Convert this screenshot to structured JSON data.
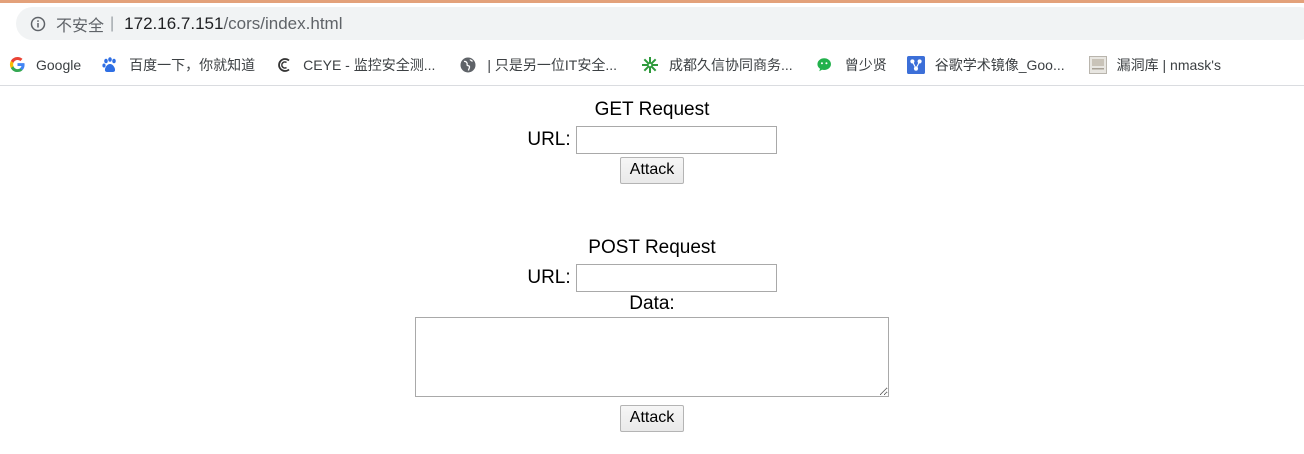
{
  "address_bar": {
    "security_label": "不安全",
    "separator": "|",
    "url_host": "172.16.7.151",
    "url_path": "/cors/index.html"
  },
  "bookmarks": [
    {
      "label": "Google",
      "icon": "google-icon"
    },
    {
      "label": "百度一下，你就知道",
      "icon": "baidu-paw-icon"
    },
    {
      "label": "CEYE - 监控安全测...",
      "icon": "ceye-icon"
    },
    {
      "label": "| 只是另一位IT安全...",
      "icon": "globe-icon"
    },
    {
      "label": "成都久信协同商务...",
      "icon": "gear-flower-icon"
    },
    {
      "label": "曾少贤",
      "icon": "wechat-icon"
    },
    {
      "label": "谷歌学术镜像_Goo...",
      "icon": "scholar-mirror-icon"
    },
    {
      "label": "漏洞库 | nmask's",
      "icon": "page-thumbnail-icon"
    }
  ],
  "get_form": {
    "heading": "GET Request",
    "url_label": "URL:",
    "url_value": "",
    "button_label": "Attack"
  },
  "post_form": {
    "heading": "POST Request",
    "url_label": "URL:",
    "url_value": "",
    "data_label": "Data:",
    "data_value": "",
    "button_label": "Attack"
  },
  "colors": {
    "accent_line": "#e3a17a",
    "omnibox_bg": "#f1f3f4"
  }
}
